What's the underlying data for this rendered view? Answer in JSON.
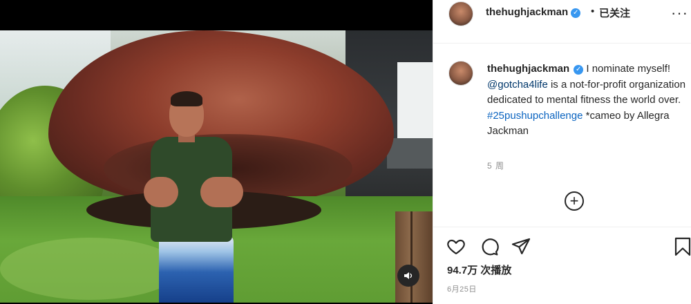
{
  "header": {
    "username": "thehughjackman",
    "separator": "•",
    "follow_status": "已关注",
    "more_icon": "more-horizontal-icon"
  },
  "caption": {
    "username": "thehughjackman",
    "text_1": "I nominate myself!",
    "mention": "@gotcha4life",
    "text_2": "is a not-for-profit organization dedicated to mental fitness the world over.",
    "hashtag": "#25pushupchallenge",
    "text_3": "*cameo by Allegra Jackman",
    "time_ago": "5 周"
  },
  "load_more_symbol": "+",
  "actions": {
    "like_icon": "heart-icon",
    "comment_icon": "comment-icon",
    "share_icon": "paper-plane-icon",
    "save_icon": "bookmark-icon"
  },
  "stats": {
    "views": "94.7万 次播放",
    "date": "6月25日"
  },
  "colors": {
    "verified_blue": "#3897f0",
    "link_blue": "#00376b",
    "muted_gray": "#8e8e8e",
    "text": "#262626"
  }
}
